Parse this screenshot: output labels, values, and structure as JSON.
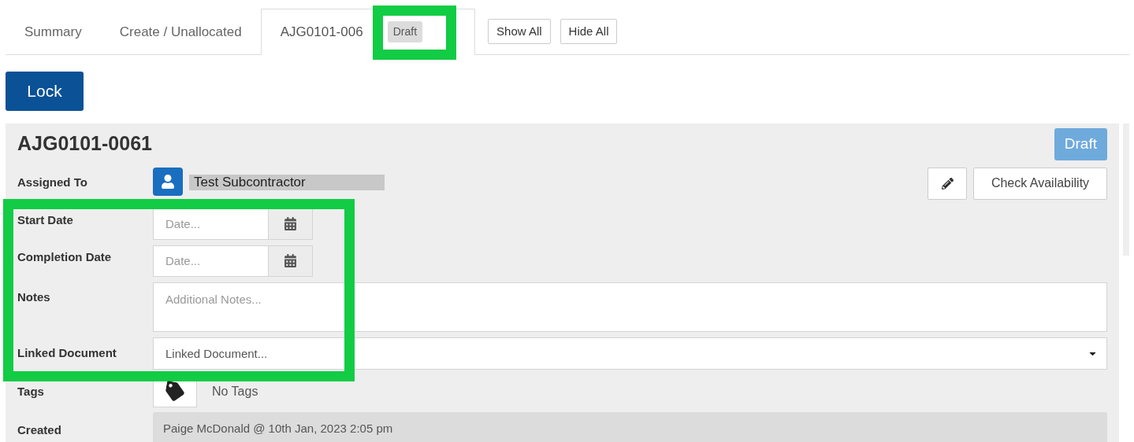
{
  "tabs": [
    {
      "label": "Summary",
      "selected": false
    },
    {
      "label": "Create / Unallocated",
      "selected": false
    },
    {
      "label": "AJG0101-006",
      "selected": true,
      "badge": "Draft",
      "badge_highlighted": true
    }
  ],
  "tab_buttons": [
    "Show All",
    "Hide All"
  ],
  "lock_button": "Lock",
  "record": {
    "title": "AJG0101-0061",
    "status": "Draft",
    "assigned_label": "Assigned To",
    "assigned_to": "Test Subcontractor",
    "check_button": "Check Availability",
    "fields_highlighted": true,
    "start_date": {
      "label": "Start Date",
      "placeholder": "Date..."
    },
    "completion_date": {
      "label": "Completion Date",
      "placeholder": "Date..."
    },
    "notes": {
      "label": "Notes",
      "placeholder": "Additional Notes..."
    },
    "linked_document": {
      "label": "Linked Document",
      "placeholder": "Linked Document..."
    },
    "tags": {
      "label": "Tags",
      "value": "No Tags"
    },
    "created": {
      "label": "Created",
      "value": "Paige McDonald @ 10th Jan, 2023 2:05 pm"
    }
  }
}
